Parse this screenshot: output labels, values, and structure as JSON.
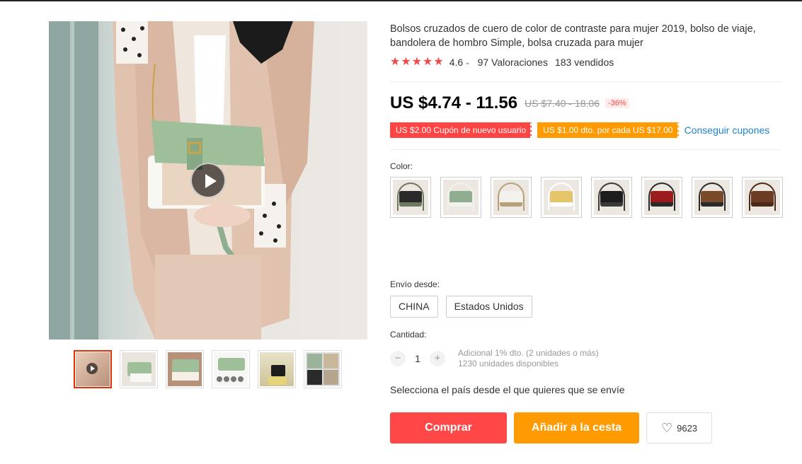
{
  "product": {
    "title": "Bolsos cruzados de cuero de color de contraste para mujer 2019, bolso de viaje, bandolera de hombro Simple, bolsa cruzada para mujer",
    "rating": "4.6",
    "reviews": "97 Valoraciones",
    "sold": "183 vendidos",
    "price": "US $4.74 - 11.56",
    "old_price": "US $7.40 - 18.06",
    "discount": "-36%"
  },
  "coupons": {
    "new_user": "US $2.00 Cupón de nuevo usuario",
    "per_amount": "US $1.00 dto. por cada US $17.00",
    "get_link": "Conseguir cupones"
  },
  "color": {
    "label": "Color:",
    "swatches": [
      {
        "bag": "#2a2a2a",
        "accent": "#6d7a5e"
      },
      {
        "bag": "#8fae8f",
        "accent": "#f2f2ee"
      },
      {
        "bag": "#f3f1ec",
        "accent": "#b8a07a"
      },
      {
        "bag": "#e6c56a",
        "accent": "#ffffff"
      },
      {
        "bag": "#1d1d1d",
        "accent": "#3a3a3a"
      },
      {
        "bag": "#9b1c1c",
        "accent": "#2a2a2a"
      },
      {
        "bag": "#7a4b2a",
        "accent": "#2a2a2a"
      },
      {
        "bag": "#6b3b23",
        "accent": "#4a2a18"
      }
    ]
  },
  "shipping": {
    "label": "Envío desde:",
    "options": [
      "CHINA",
      "Estados Unidos"
    ],
    "country_prompt": "Selecciona el país desde el que quieres que se envíe"
  },
  "quantity": {
    "label": "Cantidad:",
    "value": "1",
    "minus": "−",
    "plus": "+",
    "bulk_discount": "Adicional 1% dto. (2 unidades o más)",
    "available": "1230 unidades disponibles"
  },
  "actions": {
    "buy": "Comprar",
    "add_to_cart": "Añadir a la cesta",
    "wishlist_count": "9623"
  },
  "colors": {
    "accent_red": "#ff4747",
    "accent_orange": "#ff9a00",
    "link_blue": "#1e84c9",
    "star_red": "#f04a4a"
  }
}
